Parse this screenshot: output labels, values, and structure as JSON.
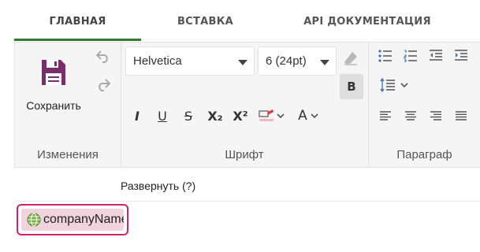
{
  "tabs": [
    {
      "label": "ГЛАВНАЯ",
      "active": true
    },
    {
      "label": "ВСТАВКА",
      "active": false
    },
    {
      "label": "API ДОКУМЕНТАЦИЯ",
      "active": false
    }
  ],
  "ribbon": {
    "changes": {
      "save_label": "Сохранить",
      "group_label": "Изменения"
    },
    "font": {
      "family_value": "Helvetica",
      "size_value": "6 (24pt)",
      "group_label": "Шрифт",
      "bold_label": "B",
      "italic_label": "I",
      "underline_label": "U",
      "strike_label": "S",
      "subscript_label": "X₂",
      "superscript_label": "X²",
      "font_color_label": "A"
    },
    "paragraph": {
      "group_label": "Параграф"
    }
  },
  "expand": {
    "label": "Развернуть (?)"
  },
  "chip": {
    "text": "companyName"
  },
  "colors": {
    "accent_tab": "#2e7d32",
    "save_icon": "#7b2d6b",
    "chip_border": "#d2246c",
    "chip_fill": "#f0d3dd"
  },
  "icons": [
    "save-icon",
    "undo-icon",
    "redo-icon",
    "eraser-icon",
    "highlighter-icon",
    "bullet-list-icon",
    "numbered-list-icon",
    "outdent-icon",
    "indent-icon",
    "line-spacing-icon",
    "align-left-icon",
    "align-center-icon",
    "align-right-icon",
    "justify-icon",
    "globe-icon"
  ]
}
